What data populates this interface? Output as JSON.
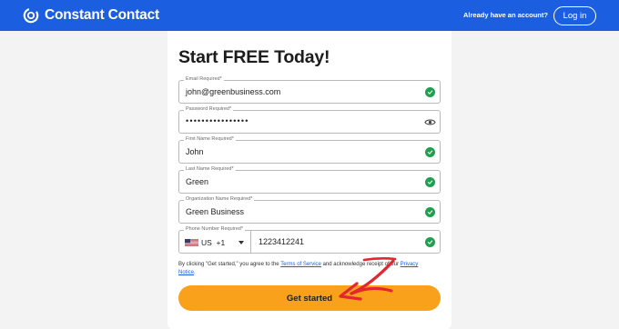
{
  "header": {
    "brand": "Constant Contact",
    "already_text": "Already have an account?",
    "login_label": "Log in"
  },
  "form": {
    "title": "Start FREE Today!",
    "email": {
      "label": "Email Required",
      "required_mark": "*",
      "value": "john@greenbusiness.com"
    },
    "password": {
      "label": "Password Required",
      "required_mark": "*",
      "value": "••••••••••••••••"
    },
    "first_name": {
      "label": "First Name Required",
      "required_mark": "*",
      "value": "John"
    },
    "last_name": {
      "label": "Last Name Required",
      "required_mark": "*",
      "value": "Green"
    },
    "organization": {
      "label": "Organization Name Required",
      "required_mark": "*",
      "value": "Green Business"
    },
    "phone": {
      "label": "Phone Number Required",
      "required_mark": "*",
      "country": "US",
      "dial_code": "+1",
      "value": "1223412241"
    },
    "terms": {
      "prefix": "By clicking \"Get started,\" you agree to the",
      "link1": "Terms of Service",
      "middle": "and acknowledge receipt of our",
      "link2": "Privacy Notice",
      "suffix": "."
    },
    "submit_label": "Get started"
  },
  "colors": {
    "header_bg": "#1b5fe0",
    "cta_bg": "#f9a11b",
    "valid_check": "#1ea14f",
    "annotation_arrow": "#e3262f"
  },
  "icons": {
    "brand": "constant-contact-logo-icon",
    "valid": "check-circle-icon",
    "password_toggle": "eye-icon",
    "country_flag": "us-flag-icon",
    "dropdown": "chevron-down-icon"
  }
}
